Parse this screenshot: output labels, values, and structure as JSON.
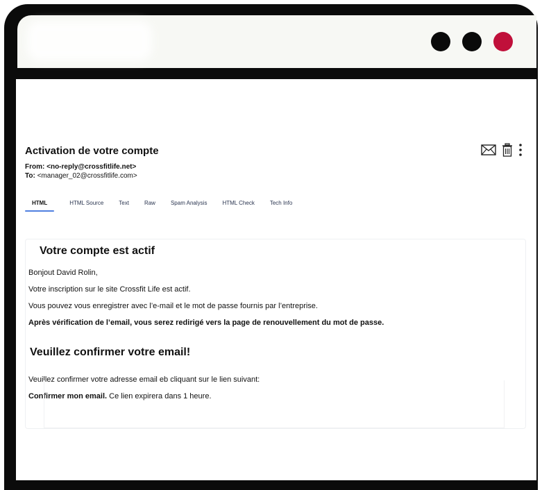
{
  "window": {
    "dot_colors": [
      "#0a0a0a",
      "#0a0a0a",
      "#c0103a"
    ]
  },
  "email": {
    "subject": "Activation de votre compte",
    "from_label": "From:",
    "from_value": "<no-reply@crossfitlife.net>",
    "to_label": "To:",
    "to_value": "<manager_02@crossfitlife.com>"
  },
  "actions": {
    "icons": [
      "envelope-icon",
      "trash-icon",
      "more-vertical-icon"
    ]
  },
  "tabs": [
    {
      "label": "HTML",
      "active": true
    },
    {
      "label": "HTML Source",
      "active": false
    },
    {
      "label": "Text",
      "active": false
    },
    {
      "label": "Raw",
      "active": false
    },
    {
      "label": "Spam Analysis",
      "active": false
    },
    {
      "label": "HTML Check",
      "active": false
    },
    {
      "label": "Tech Info",
      "active": false
    }
  ],
  "message": {
    "heading1": "Votre compte est actif",
    "greeting": "Bonjout David Rolin,",
    "line1": "Votre inscription sur le site Crossfit Life est actif.",
    "line2": "Vous pouvez vous enregistrer avec l’e-mail et le mot de passe fournis par l’entreprise.",
    "line3": "Après vérification de l’email, vous serez redirigé vers la page de renouvellement du mot de passe.",
    "heading2": "Veuillez confirmer votre email!",
    "line4": "Veuillez confirmer votre adresse email eb cliquant sur le lien suivant:",
    "link_text": "Confirmer mon email.",
    "link_suffix": " Ce lien expirera dans 1 heure."
  }
}
